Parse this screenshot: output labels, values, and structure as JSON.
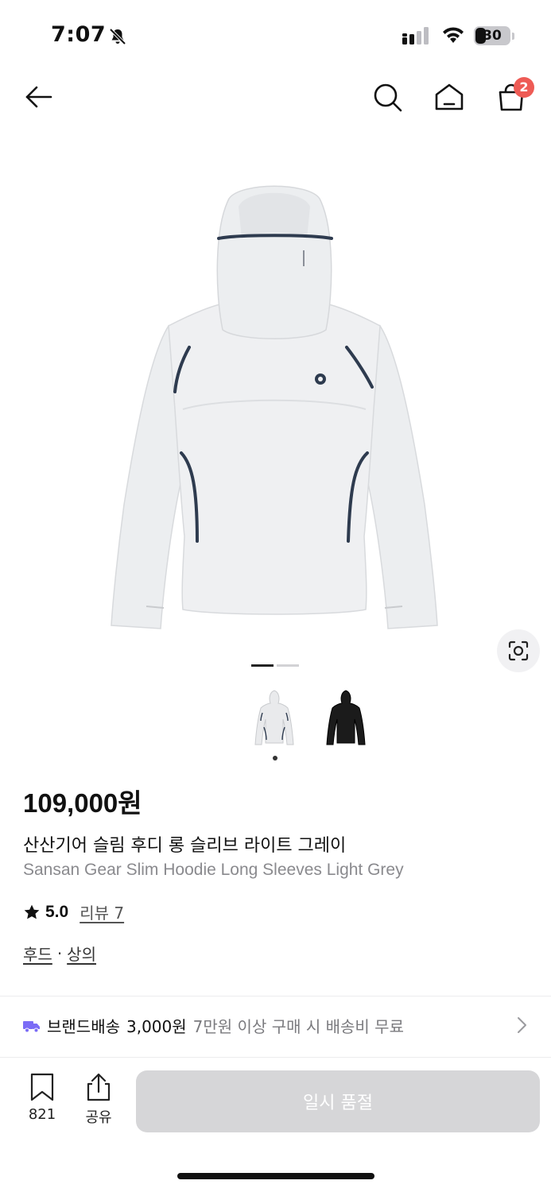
{
  "status_bar": {
    "time": "7:07",
    "battery": "30"
  },
  "header": {
    "cart_count": "2"
  },
  "product": {
    "price": "109,000원",
    "name_ko": "산산기어 슬림 후디 롱 슬리브 라이트 그레이",
    "name_en": "Sansan Gear Slim Hoodie Long Sleeves Light Grey",
    "rating": "5.0",
    "review_label": "리뷰 7",
    "categories": [
      "후드",
      "상의"
    ],
    "category_separator": "·",
    "image_count": 2,
    "selected_image": 1,
    "colors": {
      "body": "#eeeff1",
      "trim": "#2e3b4f",
      "dark": "#1b1b1b"
    }
  },
  "shipping": {
    "label": "브랜드배송",
    "fee": "3,000원",
    "condition": "7만원 이상 구매 시 배송비 무료",
    "icon": "truck-icon",
    "icon_color": "#7b6cf6"
  },
  "bottom_bar": {
    "bookmark_count": "821",
    "share_label": "공유",
    "soldout_label": "일시 품절"
  },
  "colors": {
    "badge": "#ee5b55",
    "disabled_button": "#d6d6d8"
  }
}
